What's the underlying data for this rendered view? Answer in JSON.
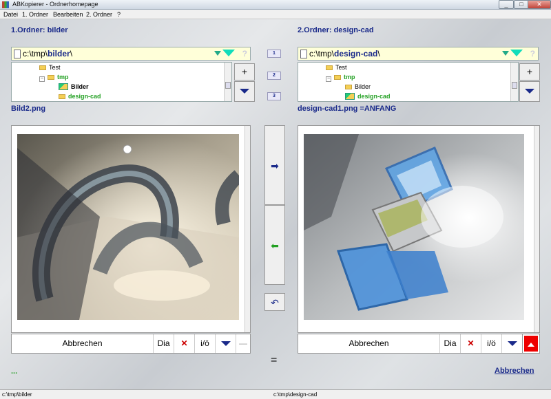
{
  "window": {
    "title": "ABKopierer - Ordnerhomepage",
    "min": "_",
    "max": "□",
    "close": "✕"
  },
  "menu": [
    "Datei",
    "1. Ordner",
    "Bearbeiten",
    "2. Ordner",
    "?"
  ],
  "left": {
    "heading": "1.Ordner: bilder",
    "path_prefix": "c:\\tmp\\",
    "path_current": "bilder",
    "path_suffix": "\\",
    "help": "?",
    "tree": [
      {
        "label": "Test",
        "type": "folder",
        "style": "normal"
      },
      {
        "label": "tmp",
        "type": "folder-plus",
        "style": "green"
      },
      {
        "label": "Bilder",
        "type": "open",
        "style": "bold"
      },
      {
        "label": "design-cad",
        "type": "folder",
        "style": "green"
      }
    ],
    "filename": "Bild2.png",
    "toolbar": {
      "cancel": "Abbrechen",
      "dia": "Dia",
      "x": "✕",
      "io": "i/ö",
      "minus": "—"
    }
  },
  "right": {
    "heading": "2.Ordner: design-cad",
    "path_prefix": "c:\\tmp\\",
    "path_current": "design-cad",
    "path_suffix": "\\",
    "help": "?",
    "tree": [
      {
        "label": "Test",
        "type": "folder",
        "style": "normal"
      },
      {
        "label": "tmp",
        "type": "folder-plus",
        "style": "green"
      },
      {
        "label": "Bilder",
        "type": "folder",
        "style": "normal"
      },
      {
        "label": "design-cad",
        "type": "open",
        "style": "green"
      }
    ],
    "filename": "design-cad1.png =ANFANG",
    "toolbar": {
      "cancel": "Abbrechen",
      "dia": "Dia",
      "x": "✕",
      "io": "i/ö"
    }
  },
  "middle": {
    "num_icons": [
      "1",
      "2",
      "3"
    ],
    "right_arrow": "➡",
    "left_arrow": "⬅",
    "undo": "↶",
    "equals": "="
  },
  "side_plus": "+",
  "bottom": {
    "dots": "...",
    "cancel": "Abbrechen"
  },
  "status": {
    "left": "c:\\tmp\\bilder",
    "right": "c:\\tmp\\design-cad"
  },
  "colors": {
    "accent": "#1a2a8a",
    "green": "#22a022",
    "red": "#e00000",
    "path_bg": "#ffffd9"
  }
}
